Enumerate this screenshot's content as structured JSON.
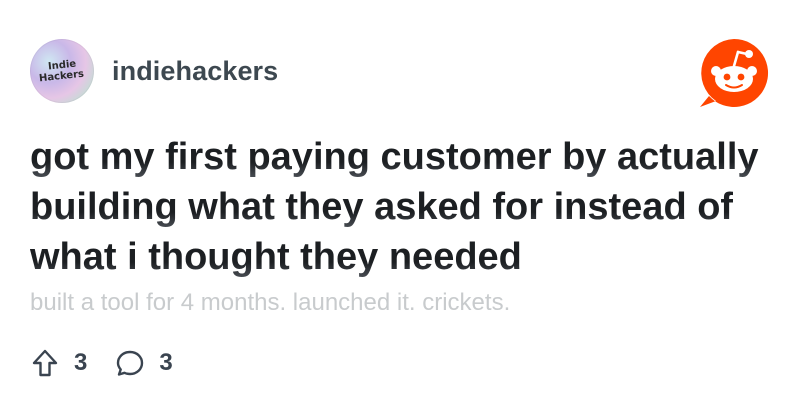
{
  "post": {
    "community": "indiehackers",
    "avatar": {
      "line1": "Indie",
      "line2": "Hackers",
      "icon": "community-avatar"
    },
    "title": "got my first paying customer by actually building what they asked for instead of what i thought they needed",
    "body_preview": "built a tool for 4 months. launched it. crickets."
  },
  "stats": {
    "upvotes": "3",
    "comments": "3",
    "upvote_icon": "arrow-up-icon",
    "comment_icon": "speech-bubble-icon"
  },
  "logo": {
    "icon": "reddit-logo-icon",
    "color": "#ff4500"
  },
  "colors": {
    "title": "#1c1f22",
    "community": "#3d4850",
    "body_preview": "#c8cbcd",
    "stat_text": "#3a4450"
  }
}
